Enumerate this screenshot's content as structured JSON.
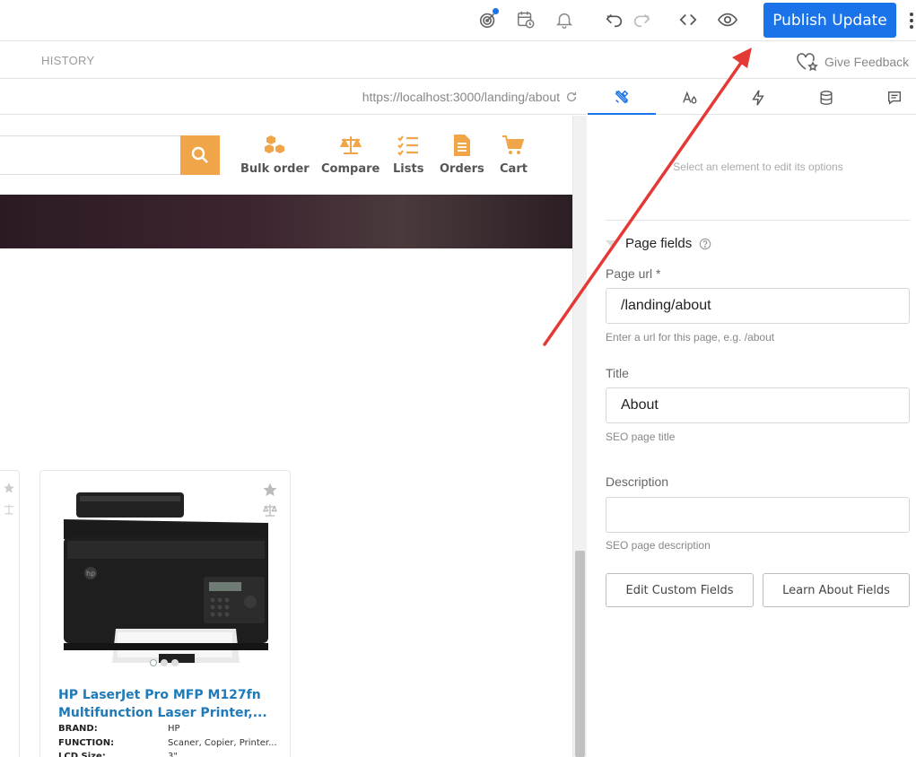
{
  "toolbar": {
    "publish_label": "Publish Update",
    "icons": [
      "target-icon",
      "calendar-clock-icon",
      "bell-icon",
      "undo-icon",
      "redo-icon",
      "code-icon",
      "eye-icon",
      "kebab-menu-icon"
    ]
  },
  "secondbar": {
    "history_label": "HISTORY",
    "feedback_label": "Give Feedback"
  },
  "urlbar": {
    "url": "https://localhost:3000/landing/about"
  },
  "site": {
    "nav": [
      {
        "label": "Bulk order",
        "icon": "boxes-icon"
      },
      {
        "label": "Compare",
        "icon": "scale-icon"
      },
      {
        "label": "Lists",
        "icon": "checklist-icon"
      },
      {
        "label": "Orders",
        "icon": "document-icon"
      },
      {
        "label": "Cart",
        "icon": "cart-icon"
      }
    ],
    "accent": "#f0a548",
    "product": {
      "title": "HP LaserJet Pro MFP M127fn Multifunction Laser Printer,...",
      "specs": [
        {
          "key": "BRAND:",
          "value": "HP"
        },
        {
          "key": "FUNCTION:",
          "value": "Scaner, Copier, Printer..."
        },
        {
          "key": "LCD Size:",
          "value": "3\""
        }
      ]
    }
  },
  "panel": {
    "tabs": [
      "style-icon",
      "typography-icon",
      "lightning-icon",
      "database-icon",
      "comment-icon"
    ],
    "hint": "Select an element to edit its options",
    "section_title": "Page fields",
    "fields": {
      "url_label": "Page url *",
      "url_value": "/landing/about",
      "url_help": "Enter a url for this page, e.g. /about",
      "title_label": "Title",
      "title_value": "About",
      "title_help": "SEO page title",
      "desc_label": "Description",
      "desc_value": "",
      "desc_help": "SEO page description"
    },
    "edit_custom_label": "Edit Custom Fields",
    "learn_label": "Learn About Fields"
  },
  "colors": {
    "primary": "#1a73e8",
    "annotation_arrow": "#e53935",
    "link": "#1e7ab8"
  }
}
